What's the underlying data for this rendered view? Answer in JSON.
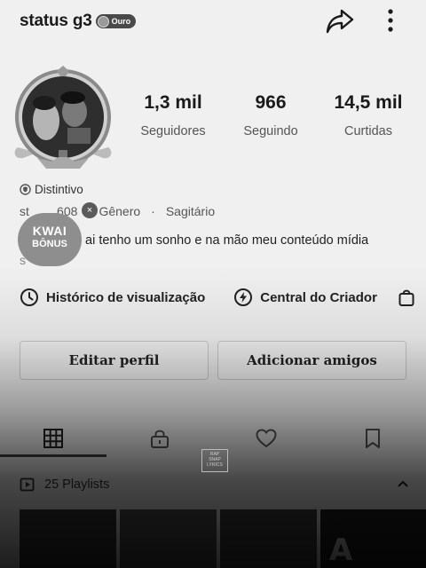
{
  "header": {
    "username": "status g3",
    "badge_label": "Ouro",
    "share_icon": "share-arrow-icon",
    "more_icon": "more-vertical-icon"
  },
  "stats": [
    {
      "value": "1,3 mil",
      "label": "Seguidores"
    },
    {
      "value": "966",
      "label": "Seguindo"
    },
    {
      "value": "14,5 mil",
      "label": "Curtidas"
    }
  ],
  "profile": {
    "badge_text": "Distintivo",
    "id_text": "st",
    "id_suffix": "608",
    "gender": "+ Gênero",
    "sign": "Sagitário",
    "separator": "·",
    "bio_line1": "ai tenho um sonho e na mão meu conteúdo mídia",
    "bio_line2": "s"
  },
  "kwai_bonus": {
    "line1": "KWAI",
    "line2": "BÔNUS",
    "close": "×"
  },
  "shortcuts": [
    {
      "label": "Histórico de visualização",
      "icon": "clock-icon"
    },
    {
      "label": "Central do Criador",
      "icon": "lightning-icon"
    },
    {
      "label": "",
      "icon": "shopping-bag-icon"
    }
  ],
  "actions": {
    "edit_profile": "Editar perfil",
    "add_friends": "Adicionar amigos"
  },
  "tabs": [
    {
      "icon": "grid-icon",
      "active": true
    },
    {
      "icon": "lock-icon",
      "active": false
    },
    {
      "icon": "heart-icon",
      "active": false
    },
    {
      "icon": "bookmark-icon",
      "active": false
    }
  ],
  "watermark": {
    "line1": "RAP",
    "line2": "SNAP",
    "line3": "LYRICS"
  },
  "playlists": {
    "label": "25 Playlists"
  },
  "thumb_text": "A"
}
